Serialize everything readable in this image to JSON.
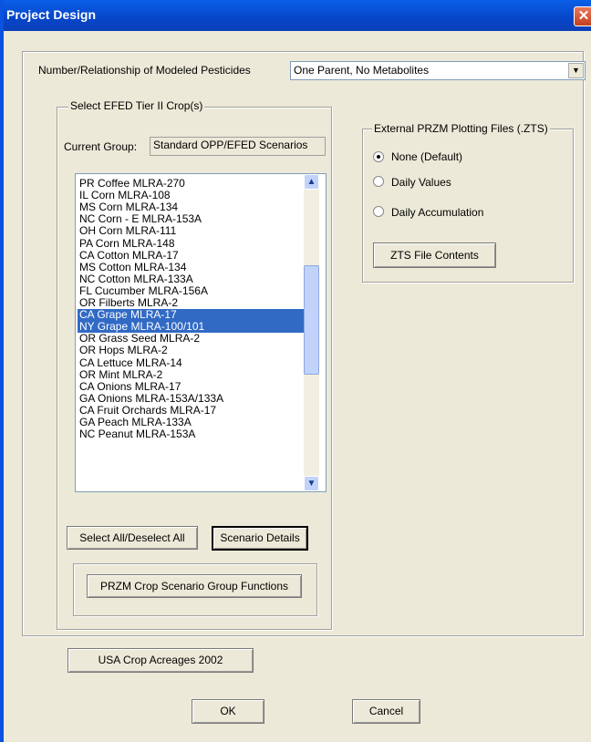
{
  "window": {
    "title": "Project Design",
    "close_glyph": "✕"
  },
  "pesticides": {
    "label": "Number/Relationship of Modeled Pesticides",
    "value": "One Parent, No Metabolites"
  },
  "crops": {
    "group_label": "Select EFED Tier II Crop(s)",
    "current_group_label": "Current Group:",
    "current_group_value": "Standard OPP/EFED Scenarios",
    "items": [
      "PR Coffee MLRA-270",
      "IL Corn  MLRA-108",
      "MS Corn  MLRA-134",
      "NC Corn - E  MLRA-153A",
      "OH Corn  MLRA-111",
      "PA Corn  MLRA-148",
      "CA Cotton  MLRA-17",
      "MS Cotton  MLRA-134",
      "NC Cotton  MLRA-133A",
      "FL Cucumber  MLRA-156A",
      "OR Filberts  MLRA-2",
      "CA Grape  MLRA-17",
      "NY Grape  MLRA-100/101",
      "OR Grass Seed  MLRA-2",
      "OR Hops  MLRA-2",
      "CA Lettuce  MLRA-14",
      "OR Mint  MLRA-2",
      "CA Onions MLRA-17",
      "GA Onions MLRA-153A/133A",
      "CA Fruit Orchards MLRA-17",
      "GA Peach  MLRA-133A",
      "NC Peanut  MLRA-153A"
    ],
    "selected": [
      "CA Grape  MLRA-17",
      "NY Grape  MLRA-100/101"
    ],
    "select_all_label": "Select All/Deselect All",
    "scenario_details_label": "Scenario Details",
    "group_functions_label": "PRZM Crop Scenario Group Functions"
  },
  "zts": {
    "group_label": "External PRZM Plotting Files (.ZTS)",
    "options": [
      "None (Default)",
      "Daily Values",
      "Daily Accumulation"
    ],
    "selected": "None (Default)",
    "contents_label": "ZTS File Contents"
  },
  "footer": {
    "acreages_label": "USA Crop Acreages 2002",
    "ok_label": "OK",
    "cancel_label": "Cancel"
  },
  "colors": {
    "title_bar": "#0a5fe8",
    "selection": "#316ac5",
    "face": "#ece9d8"
  }
}
